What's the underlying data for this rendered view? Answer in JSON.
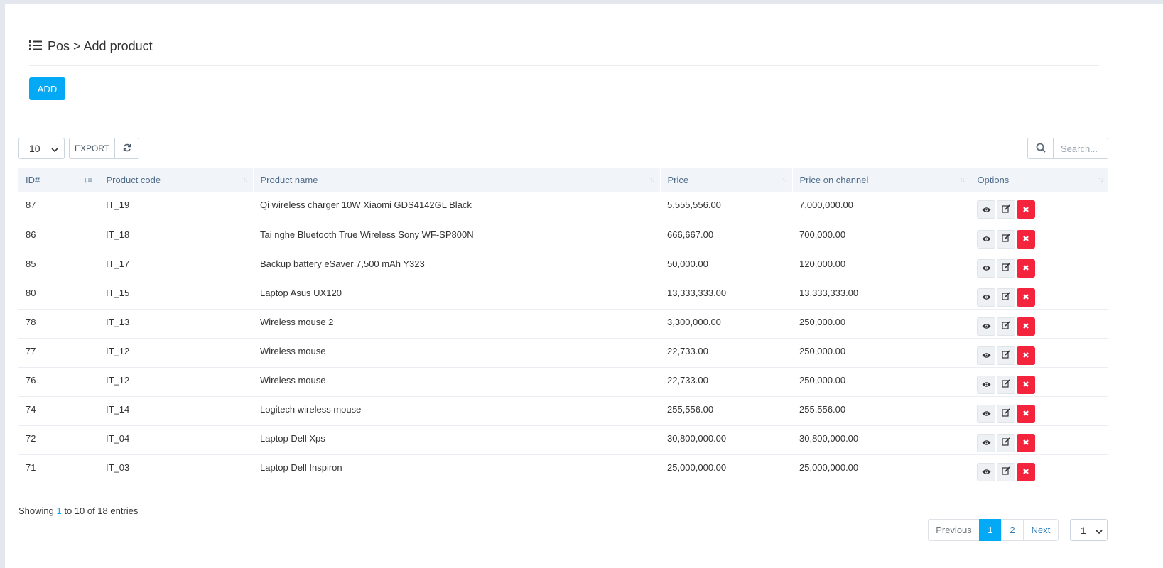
{
  "header": {
    "title": "Pos > Add product",
    "icon": "list-icon"
  },
  "add_button": "ADD",
  "toolbar": {
    "page_length": "10",
    "export_label": "EXPORT",
    "search_placeholder": "Search..."
  },
  "table": {
    "columns": [
      "ID#",
      "Product code",
      "Product name",
      "Price",
      "Price on channel",
      "Options"
    ],
    "rows": [
      {
        "id": "87",
        "code": "IT_19",
        "name": "Qi wireless charger 10W Xiaomi GDS4142GL Black",
        "price": "5,555,556.00",
        "channel": "7,000,000.00"
      },
      {
        "id": "86",
        "code": "IT_18",
        "name": "Tai nghe Bluetooth True Wireless Sony WF-SP800N",
        "price": "666,667.00",
        "channel": "700,000.00"
      },
      {
        "id": "85",
        "code": "IT_17",
        "name": "Backup battery eSaver 7,500 mAh Y323",
        "price": "50,000.00",
        "channel": "120,000.00"
      },
      {
        "id": "80",
        "code": "IT_15",
        "name": "Laptop Asus UX120",
        "price": "13,333,333.00",
        "channel": "13,333,333.00"
      },
      {
        "id": "78",
        "code": "IT_13",
        "name": "Wireless mouse 2",
        "price": "3,300,000.00",
        "channel": "250,000.00"
      },
      {
        "id": "77",
        "code": "IT_12",
        "name": "Wireless mouse",
        "price": "22,733.00",
        "channel": "250,000.00"
      },
      {
        "id": "76",
        "code": "IT_12",
        "name": "Wireless mouse",
        "price": "22,733.00",
        "channel": "250,000.00"
      },
      {
        "id": "74",
        "code": "IT_14",
        "name": "Logitech wireless mouse",
        "price": "255,556.00",
        "channel": "255,556.00"
      },
      {
        "id": "72",
        "code": "IT_04",
        "name": "Laptop Dell Xps",
        "price": "30,800,000.00",
        "channel": "30,800,000.00"
      },
      {
        "id": "71",
        "code": "IT_03",
        "name": "Laptop Dell Inspiron",
        "price": "25,000,000.00",
        "channel": "25,000,000.00"
      }
    ]
  },
  "info": {
    "prefix": "Showing ",
    "start": "1",
    "middle": " to 10 of 18 entries"
  },
  "pagination": {
    "previous": "Previous",
    "pages": [
      "1",
      "2"
    ],
    "current": "1",
    "next": "Next",
    "jump": "1"
  },
  "colors": {
    "primary": "#03a9f4",
    "danger": "#f4243d",
    "header_text": "#4f6b8a"
  }
}
